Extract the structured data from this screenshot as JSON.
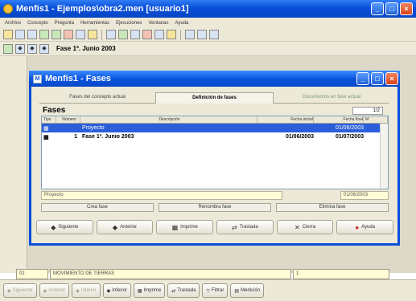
{
  "window": {
    "title": "Menfis1 - Ejemplos\\obra2.men   [usuario1]"
  },
  "menu": [
    "Archivo",
    "Concepto",
    "Pregunta",
    "Herramientas",
    "Ejecuciones",
    "Ventanas",
    "Ayuda"
  ],
  "toolbar2": {
    "crumb": "Fase 1ª. Junio 2003"
  },
  "background_status": {
    "cell1": "01",
    "cell2": "MOVIMIENTO DE TIERRAS",
    "cell3": "1"
  },
  "bottom_buttons": [
    {
      "label": "Siguiente",
      "icon": "◆",
      "enabled": false
    },
    {
      "label": "Anterior",
      "icon": "◆",
      "enabled": false
    },
    {
      "label": "Inferior",
      "icon": "◆",
      "enabled": false
    },
    {
      "label": "Inferior",
      "icon": "◆",
      "enabled": true
    },
    {
      "label": "Imprime",
      "icon": "▦",
      "enabled": true
    },
    {
      "label": "Traslada",
      "icon": "⇄",
      "enabled": true
    },
    {
      "label": "Filtrar",
      "icon": "▽",
      "enabled": true
    },
    {
      "label": "Medición",
      "icon": "▤",
      "enabled": true
    }
  ],
  "dialog": {
    "title": "Menfis1 - Fases",
    "tabs": [
      "Fases del concepto actual",
      "Definición de fases",
      "Documentos en fase actual"
    ],
    "section_label": "Fases",
    "counter": "1/2",
    "columns": [
      "Tipo",
      "Número",
      "Descripción",
      "Fecha inicial",
      "Fecha final",
      "M"
    ],
    "rows": [
      {
        "num": "",
        "desc": "Proyecto",
        "fi": "",
        "ff": "01/06/2003",
        "selected": true
      },
      {
        "num": "1",
        "desc": "Fase 1ª. Junio 2003",
        "fi": "01/06/2003",
        "ff": "01/07/2003",
        "selected": false
      }
    ],
    "detail": {
      "desc": "Proyecto",
      "date": "01/06/2003"
    },
    "actions": [
      "Crea fase",
      "Renombra fase",
      "Elimina fase"
    ],
    "nav": [
      {
        "label": "Siguiente",
        "icon": "◆"
      },
      {
        "label": "Anterior",
        "icon": "◆"
      },
      {
        "label": "Imprime",
        "icon": "▦"
      },
      {
        "label": "Traslada",
        "icon": "⇄"
      },
      {
        "label": "Cierra",
        "icon": "✕"
      },
      {
        "label": "Ayuda",
        "icon": "●"
      }
    ]
  }
}
